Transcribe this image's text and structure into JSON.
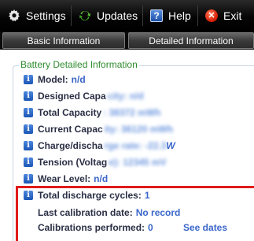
{
  "menu": {
    "settings": "Settings",
    "updates": "Updates",
    "help": "Help",
    "exit": "Exit"
  },
  "tabs": {
    "basic": "Basic Information",
    "detailed": "Detailed Information"
  },
  "panel": {
    "title": "Battery Detailed Information",
    "rows": [
      {
        "label": "Model:",
        "value": "n/d"
      },
      {
        "label": "Designed Capa",
        "hidden": "city: n/d"
      },
      {
        "label": "Total Capacity",
        "hidden": ": 38372 mWh"
      },
      {
        "label": "Current Capac",
        "hidden": "ity: 36120 mWh"
      },
      {
        "label": "Charge/discha",
        "hidden": "rge rate: -22.3",
        "value": "W"
      },
      {
        "label": "Tension (Voltag",
        "hidden": "e): 12345 mV"
      },
      {
        "label": "Wear Level:",
        "value": "n/d"
      }
    ],
    "discharge_label": "Total discharge cycles:",
    "discharge_value": "1",
    "calibration_label": "Last calibration date:",
    "calibration_value": "No record",
    "performed_label": "Calibrations performed:",
    "performed_value": "0",
    "see_dates": "See dates"
  },
  "colors": {
    "accent": "#3a66c9",
    "title_green": "#2f8b2f",
    "highlight_red": "#e01b1b"
  }
}
